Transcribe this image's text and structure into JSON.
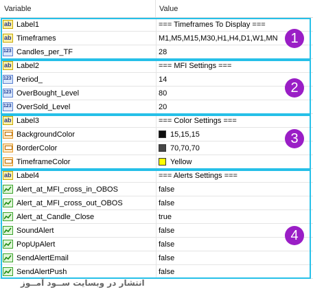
{
  "header": {
    "col_variable": "Variable",
    "col_value": "Value"
  },
  "rows": [
    {
      "name": "Label1",
      "value": "=== Timeframes To Display ===",
      "type": "ab"
    },
    {
      "name": "Timeframes",
      "value": "M1,M5,M15,M30,H1,H4,D1,W1,MN",
      "type": "ab"
    },
    {
      "name": "Candles_per_TF",
      "value": "28",
      "type": "num"
    },
    {
      "name": "Label2",
      "value": "=== MFI Settings ===",
      "type": "ab"
    },
    {
      "name": "Period_",
      "value": "14",
      "type": "num"
    },
    {
      "name": "OverBought_Level",
      "value": "80",
      "type": "num"
    },
    {
      "name": "OverSold_Level",
      "value": "20",
      "type": "num"
    },
    {
      "name": "Label3",
      "value": "=== Color Settings ===",
      "type": "ab"
    },
    {
      "name": "BackgroundColor",
      "value": "15,15,15",
      "type": "color",
      "swatch": "#0f0f0f"
    },
    {
      "name": "BorderColor",
      "value": "70,70,70",
      "type": "color",
      "swatch": "#464646"
    },
    {
      "name": "TimeframeColor",
      "value": "Yellow",
      "type": "color",
      "swatch": "#ffff00"
    },
    {
      "name": "Label4",
      "value": "=== Alerts Settings ===",
      "type": "ab"
    },
    {
      "name": "Alert_at_MFI_cross_in_OBOS",
      "value": "false",
      "type": "bool"
    },
    {
      "name": "Alert_at_MFI_cross_out_OBOS",
      "value": "false",
      "type": "bool"
    },
    {
      "name": "Alert_at_Candle_Close",
      "value": "true",
      "type": "bool"
    },
    {
      "name": "SoundAlert",
      "value": "false",
      "type": "bool"
    },
    {
      "name": "PopUpAlert",
      "value": "false",
      "type": "bool"
    },
    {
      "name": "SendAlertEmail",
      "value": "false",
      "type": "bool"
    },
    {
      "name": "SendAlertPush",
      "value": "false",
      "type": "bool"
    }
  ],
  "groups": [
    {
      "badge": "1"
    },
    {
      "badge": "2"
    },
    {
      "badge": "3"
    },
    {
      "badge": "4"
    }
  ],
  "icon_labels": {
    "ab": "ab",
    "num": "123"
  },
  "colors": {
    "group_border": "#26c0e8",
    "badge": "#9a1ec6"
  },
  "footer": {
    "watermark": "انتشار در وبسایت ســود آمــوز"
  }
}
